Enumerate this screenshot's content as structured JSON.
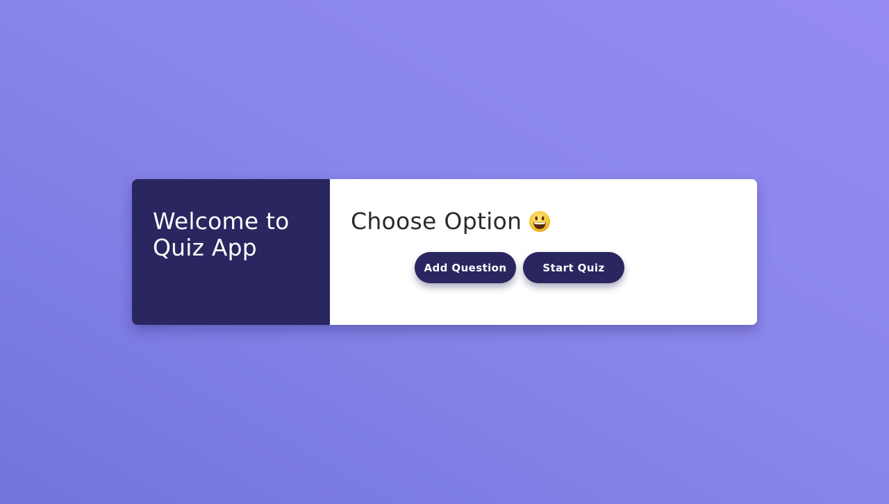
{
  "welcome": {
    "line1": "Welcome to",
    "line2": "Quiz App"
  },
  "options": {
    "title": "Choose Option",
    "emoji_icon": "smiling-face-icon"
  },
  "buttons": {
    "add_question": "Add Question",
    "start_quiz": "Start Quiz"
  },
  "colors": {
    "panel_dark": "#2a2660",
    "background_gradient_start": "#7374dc",
    "background_gradient_end": "#958bf0"
  }
}
